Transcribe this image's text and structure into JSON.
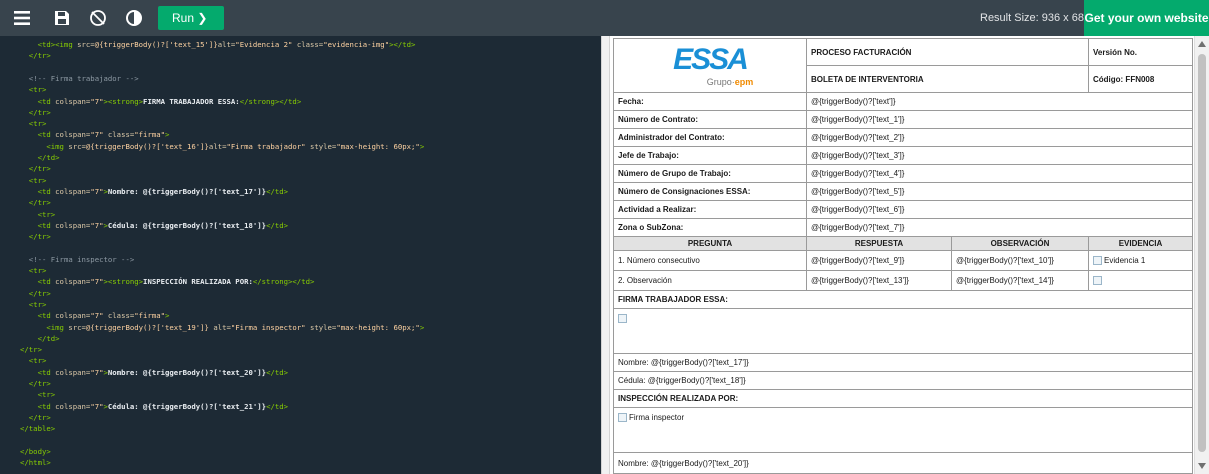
{
  "toolbar": {
    "menu_icon": "hamburger-menu-icon",
    "save_icon": "save-icon",
    "orientation_icon": "rotate-icon",
    "theme_icon": "contrast-icon",
    "run_label": "Run ❯",
    "result_size": "Result Size: 936 x 683",
    "get_site_label": "Get your own website"
  },
  "editor": {
    "lines": [
      {
        "indent": "    ",
        "parts": [
          [
            "tag",
            "<td><img"
          ],
          [
            "att",
            " src="
          ],
          [
            "str",
            "@{triggerBody()?['text_15']}"
          ],
          [
            "att",
            "alt="
          ],
          [
            "str",
            "\"Evidencia 2\""
          ],
          [
            "att",
            " class="
          ],
          [
            "str",
            "\"evidencia-img\""
          ],
          [
            "tag",
            "></td>"
          ]
        ]
      },
      {
        "indent": "  ",
        "parts": [
          [
            "tag",
            "</tr>"
          ]
        ]
      },
      {
        "indent": "",
        "parts": [
          [
            "txt",
            " "
          ]
        ]
      },
      {
        "indent": "  ",
        "parts": [
          [
            "com",
            "<!-- Firma trabajador -->"
          ]
        ]
      },
      {
        "indent": "  ",
        "parts": [
          [
            "tag",
            "<tr>"
          ]
        ]
      },
      {
        "indent": "    ",
        "parts": [
          [
            "tag",
            "<td"
          ],
          [
            "att",
            " colspan="
          ],
          [
            "str",
            "\"7\""
          ],
          [
            "tag",
            "><strong>"
          ],
          [
            "bold",
            "FIRMA TRABAJADOR ESSA:"
          ],
          [
            "tag",
            "</strong></td>"
          ]
        ]
      },
      {
        "indent": "  ",
        "parts": [
          [
            "tag",
            "</tr>"
          ]
        ]
      },
      {
        "indent": "  ",
        "parts": [
          [
            "tag",
            "<tr>"
          ]
        ]
      },
      {
        "indent": "    ",
        "parts": [
          [
            "tag",
            "<td"
          ],
          [
            "att",
            " colspan="
          ],
          [
            "str",
            "\"7\""
          ],
          [
            "att",
            " class="
          ],
          [
            "str",
            "\"firma\""
          ],
          [
            "tag",
            ">"
          ]
        ]
      },
      {
        "indent": "      ",
        "parts": [
          [
            "tag",
            "<img"
          ],
          [
            "att",
            " src="
          ],
          [
            "str",
            "@{triggerBody()?['text_16']}"
          ],
          [
            "att",
            "alt="
          ],
          [
            "str",
            "\"Firma trabajador\""
          ],
          [
            "att",
            " style="
          ],
          [
            "str",
            "\"max-height: 60px;\""
          ],
          [
            "tag",
            ">"
          ]
        ]
      },
      {
        "indent": "    ",
        "parts": [
          [
            "tag",
            "</td>"
          ]
        ]
      },
      {
        "indent": "  ",
        "parts": [
          [
            "tag",
            "</tr>"
          ]
        ]
      },
      {
        "indent": "  ",
        "parts": [
          [
            "tag",
            "<tr>"
          ]
        ]
      },
      {
        "indent": "    ",
        "parts": [
          [
            "tag",
            "<td"
          ],
          [
            "att",
            " colspan="
          ],
          [
            "str",
            "\"7\""
          ],
          [
            "tag",
            ">"
          ],
          [
            "bold",
            "Nombre: @{triggerBody()?['text_17']}"
          ],
          [
            "tag",
            "</td>"
          ]
        ]
      },
      {
        "indent": "  ",
        "parts": [
          [
            "tag",
            "</tr>"
          ]
        ]
      },
      {
        "indent": "    ",
        "parts": [
          [
            "tag",
            "<tr>"
          ]
        ]
      },
      {
        "indent": "    ",
        "parts": [
          [
            "tag",
            "<td"
          ],
          [
            "att",
            " colspan="
          ],
          [
            "str",
            "\"7\""
          ],
          [
            "tag",
            ">"
          ],
          [
            "bold",
            "Cédula: @{triggerBody()?['text_18']}"
          ],
          [
            "tag",
            "</td>"
          ]
        ]
      },
      {
        "indent": "  ",
        "parts": [
          [
            "tag",
            "</tr>"
          ]
        ]
      },
      {
        "indent": "",
        "parts": [
          [
            "txt",
            " "
          ]
        ]
      },
      {
        "indent": "  ",
        "parts": [
          [
            "com",
            "<!-- Firma inspector -->"
          ]
        ]
      },
      {
        "indent": "  ",
        "parts": [
          [
            "tag",
            "<tr>"
          ]
        ]
      },
      {
        "indent": "    ",
        "parts": [
          [
            "tag",
            "<td"
          ],
          [
            "att",
            " colspan="
          ],
          [
            "str",
            "\"7\""
          ],
          [
            "tag",
            "><strong>"
          ],
          [
            "bold",
            "INSPECCIÓN REALIZADA POR:"
          ],
          [
            "tag",
            "</strong></td>"
          ]
        ]
      },
      {
        "indent": "  ",
        "parts": [
          [
            "tag",
            "</tr>"
          ]
        ]
      },
      {
        "indent": "  ",
        "parts": [
          [
            "tag",
            "<tr>"
          ]
        ]
      },
      {
        "indent": "    ",
        "parts": [
          [
            "tag",
            "<td"
          ],
          [
            "att",
            " colspan="
          ],
          [
            "str",
            "\"7\""
          ],
          [
            "att",
            " class="
          ],
          [
            "str",
            "\"firma\""
          ],
          [
            "tag",
            ">"
          ]
        ]
      },
      {
        "indent": "      ",
        "parts": [
          [
            "tag",
            "<img"
          ],
          [
            "att",
            " src="
          ],
          [
            "str",
            "@{triggerBody()?['text_19']}"
          ],
          [
            "att",
            " alt="
          ],
          [
            "str",
            "\"Firma inspector\""
          ],
          [
            "att",
            " style="
          ],
          [
            "str",
            "\"max-height: 60px;\""
          ],
          [
            "tag",
            ">"
          ]
        ]
      },
      {
        "indent": "    ",
        "parts": [
          [
            "tag",
            "</td>"
          ]
        ]
      },
      {
        "indent": "",
        "parts": [
          [
            "tag",
            "</tr>"
          ]
        ]
      },
      {
        "indent": "  ",
        "parts": [
          [
            "tag",
            "<tr>"
          ]
        ]
      },
      {
        "indent": "    ",
        "parts": [
          [
            "tag",
            "<td"
          ],
          [
            "att",
            " colspan="
          ],
          [
            "str",
            "\"7\""
          ],
          [
            "tag",
            ">"
          ],
          [
            "bold",
            "Nombre: @{triggerBody()?['text_20']}"
          ],
          [
            "tag",
            "</td>"
          ]
        ]
      },
      {
        "indent": "  ",
        "parts": [
          [
            "tag",
            "</tr>"
          ]
        ]
      },
      {
        "indent": "    ",
        "parts": [
          [
            "tag",
            "<tr>"
          ]
        ]
      },
      {
        "indent": "    ",
        "parts": [
          [
            "tag",
            "<td"
          ],
          [
            "att",
            " colspan="
          ],
          [
            "str",
            "\"7\""
          ],
          [
            "tag",
            ">"
          ],
          [
            "bold",
            "Cédula: @{triggerBody()?['text_21']}"
          ],
          [
            "tag",
            "</td>"
          ]
        ]
      },
      {
        "indent": "  ",
        "parts": [
          [
            "tag",
            "</tr>"
          ]
        ]
      },
      {
        "indent": "",
        "parts": [
          [
            "tag",
            "</table>"
          ]
        ]
      },
      {
        "indent": "",
        "parts": [
          [
            "txt",
            " "
          ]
        ]
      },
      {
        "indent": "",
        "parts": [
          [
            "tag",
            "</body>"
          ]
        ]
      },
      {
        "indent": "",
        "parts": [
          [
            "tag",
            "</html>"
          ]
        ]
      }
    ]
  },
  "result": {
    "logo_text": "ESSA",
    "logo_sub_prefix": "Grupo·",
    "logo_sub_brand": "epm",
    "proceso": "PROCESO FACTURACIÓN",
    "version_label": "Versión No.",
    "boleta": "BOLETA DE INTERVENTORIA",
    "codigo": "Código: FFN008",
    "fields": [
      {
        "label": "Fecha:",
        "value": "@{triggerBody()?['text']}"
      },
      {
        "label": "Número de Contrato:",
        "value": "@{triggerBody()?['text_1']}"
      },
      {
        "label": "Administrador del Contrato:",
        "value": "@{triggerBody()?['text_2']}"
      },
      {
        "label": "Jefe de Trabajo:",
        "value": "@{triggerBody()?['text_3']}"
      },
      {
        "label": "Número de Grupo de Trabajo:",
        "value": "@{triggerBody()?['text_4']}"
      },
      {
        "label": "Número de Consignaciones ESSA:",
        "value": "@{triggerBody()?['text_5']}"
      },
      {
        "label": "Actividad a Realizar:",
        "value": "@{triggerBody()?['text_6']}"
      },
      {
        "label": "Zona o SubZona:",
        "value": "@{triggerBody()?['text_7']}"
      }
    ],
    "headers": [
      "PREGUNTA",
      "RESPUESTA",
      "OBSERVACIÓN",
      "EVIDENCIA"
    ],
    "rows": [
      {
        "pregunta": "1. Número consecutivo",
        "respuesta": "@{triggerBody()?['text_9']}",
        "observacion": "@{triggerBody()?['text_10']}",
        "evidencia": "Evidencia 1"
      },
      {
        "pregunta": "2. Observación",
        "respuesta": "@{triggerBody()?['text_13']}",
        "observacion": "@{triggerBody()?['text_14']}",
        "evidencia": ""
      }
    ],
    "firma_trabajador": "FIRMA TRABAJADOR ESSA:",
    "nombre_trabajador": "Nombre: @{triggerBody()?['text_17']}",
    "cedula_trabajador": "Cédula: @{triggerBody()?['text_18']}",
    "inspeccion": "INSPECCIÓN REALIZADA POR:",
    "firma_inspector_alt": "Firma inspector",
    "nombre_inspector": "Nombre: @{triggerBody()?['text_20']}"
  },
  "colors": {
    "editor_bg": "#1d2a35",
    "toolbar_bg": "#38444d",
    "accent_green": "#04aa6d",
    "logo_blue": "#1a8fd6",
    "logo_orange": "#f08a00"
  }
}
